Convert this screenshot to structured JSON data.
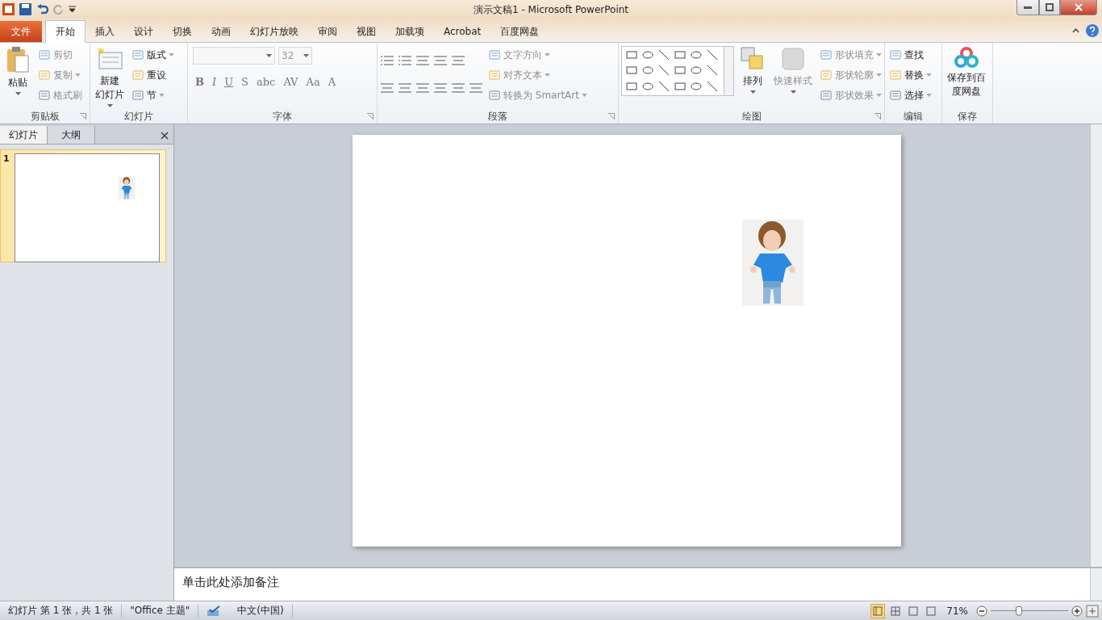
{
  "window": {
    "title": "演示文稿1  -  Microsoft PowerPoint"
  },
  "tabs": [
    {
      "label": "文件",
      "kind": "file",
      "selected": false
    },
    {
      "label": "开始",
      "kind": "tab",
      "selected": true
    },
    {
      "label": "插入",
      "kind": "tab",
      "selected": false
    },
    {
      "label": "设计",
      "kind": "tab",
      "selected": false
    },
    {
      "label": "切换",
      "kind": "tab",
      "selected": false
    },
    {
      "label": "动画",
      "kind": "tab",
      "selected": false
    },
    {
      "label": "幻灯片放映",
      "kind": "tab",
      "selected": false
    },
    {
      "label": "审阅",
      "kind": "tab",
      "selected": false
    },
    {
      "label": "视图",
      "kind": "tab",
      "selected": false
    },
    {
      "label": "加载项",
      "kind": "tab",
      "selected": false
    },
    {
      "label": "Acrobat",
      "kind": "tab",
      "selected": false
    },
    {
      "label": "百度网盘",
      "kind": "tab",
      "selected": false
    }
  ],
  "ribbon": {
    "groups": [
      {
        "label": "剪贴板",
        "launcher": true,
        "kind": "clipboard",
        "items": [
          {
            "kind": "big",
            "lines": [
              "粘贴"
            ],
            "dropdown": true,
            "disabled": false
          },
          {
            "kind": "small",
            "label": "剪切",
            "dropdown": false,
            "disabled": true
          },
          {
            "kind": "small",
            "label": "复制",
            "dropdown": true,
            "disabled": true
          },
          {
            "kind": "small",
            "label": "格式刷",
            "dropdown": false,
            "disabled": true
          }
        ]
      },
      {
        "label": "幻灯片",
        "launcher": false,
        "kind": "slides",
        "items": [
          {
            "kind": "big",
            "lines": [
              "新建",
              "幻灯片"
            ],
            "dropdown": true,
            "disabled": false
          },
          {
            "kind": "small",
            "label": "版式",
            "dropdown": true,
            "disabled": false
          },
          {
            "kind": "small",
            "label": "重设",
            "dropdown": false,
            "disabled": false
          },
          {
            "kind": "small",
            "label": "节",
            "dropdown": true,
            "disabled": false
          }
        ]
      },
      {
        "label": "字体",
        "launcher": true,
        "kind": "font",
        "font_size": "32",
        "buttons": [
          "B",
          "I",
          "U",
          "S",
          "abc",
          "AV",
          "Aa",
          "A"
        ]
      },
      {
        "label": "段落",
        "launcher": true,
        "kind": "paragraph",
        "items": [
          {
            "kind": "small",
            "label": "文字方向",
            "dropdown": true,
            "disabled": true
          },
          {
            "kind": "small",
            "label": "对齐文本",
            "dropdown": true,
            "disabled": true
          },
          {
            "kind": "small",
            "label": "转换为 SmartArt",
            "dropdown": true,
            "disabled": true
          }
        ]
      },
      {
        "label": "绘图",
        "launcher": true,
        "kind": "drawing",
        "items": [
          {
            "kind": "big",
            "lines": [
              "排列"
            ],
            "dropdown": true,
            "disabled": false
          },
          {
            "kind": "big",
            "lines": [
              "快速样式"
            ],
            "dropdown": true,
            "disabled": true
          },
          {
            "kind": "small",
            "label": "形状填充",
            "dropdown": true,
            "disabled": true
          },
          {
            "kind": "small",
            "label": "形状轮廓",
            "dropdown": true,
            "disabled": true
          },
          {
            "kind": "small",
            "label": "形状效果",
            "dropdown": true,
            "disabled": true
          }
        ]
      },
      {
        "label": "编辑",
        "launcher": false,
        "kind": "editing",
        "items": [
          {
            "kind": "small",
            "label": "查找",
            "dropdown": false,
            "disabled": false
          },
          {
            "kind": "small",
            "label": "替换",
            "dropdown": true,
            "disabled": false
          },
          {
            "kind": "small",
            "label": "选择",
            "dropdown": true,
            "disabled": false
          }
        ]
      },
      {
        "label": "保存",
        "launcher": false,
        "kind": "save",
        "items": [
          {
            "kind": "big",
            "lines": [
              "保存到百",
              "度网盘"
            ],
            "dropdown": false,
            "disabled": false
          }
        ]
      }
    ]
  },
  "side_panel": {
    "tabs": [
      {
        "label": "幻灯片",
        "selected": true
      },
      {
        "label": "大纲",
        "selected": false
      }
    ],
    "slides": [
      {
        "number": "1",
        "selected": true
      }
    ]
  },
  "notes": {
    "placeholder": "单击此处添加备注"
  },
  "status_bar": {
    "slide_info": "幻灯片 第 1 张，共 1 张",
    "theme": "\"Office 主题\"",
    "language": "中文(中国)",
    "zoom": "71%",
    "zoom_slider": {
      "level": 0.36
    },
    "views": [
      {
        "selected": true
      },
      {
        "selected": false
      },
      {
        "selected": false
      },
      {
        "selected": false
      }
    ]
  }
}
